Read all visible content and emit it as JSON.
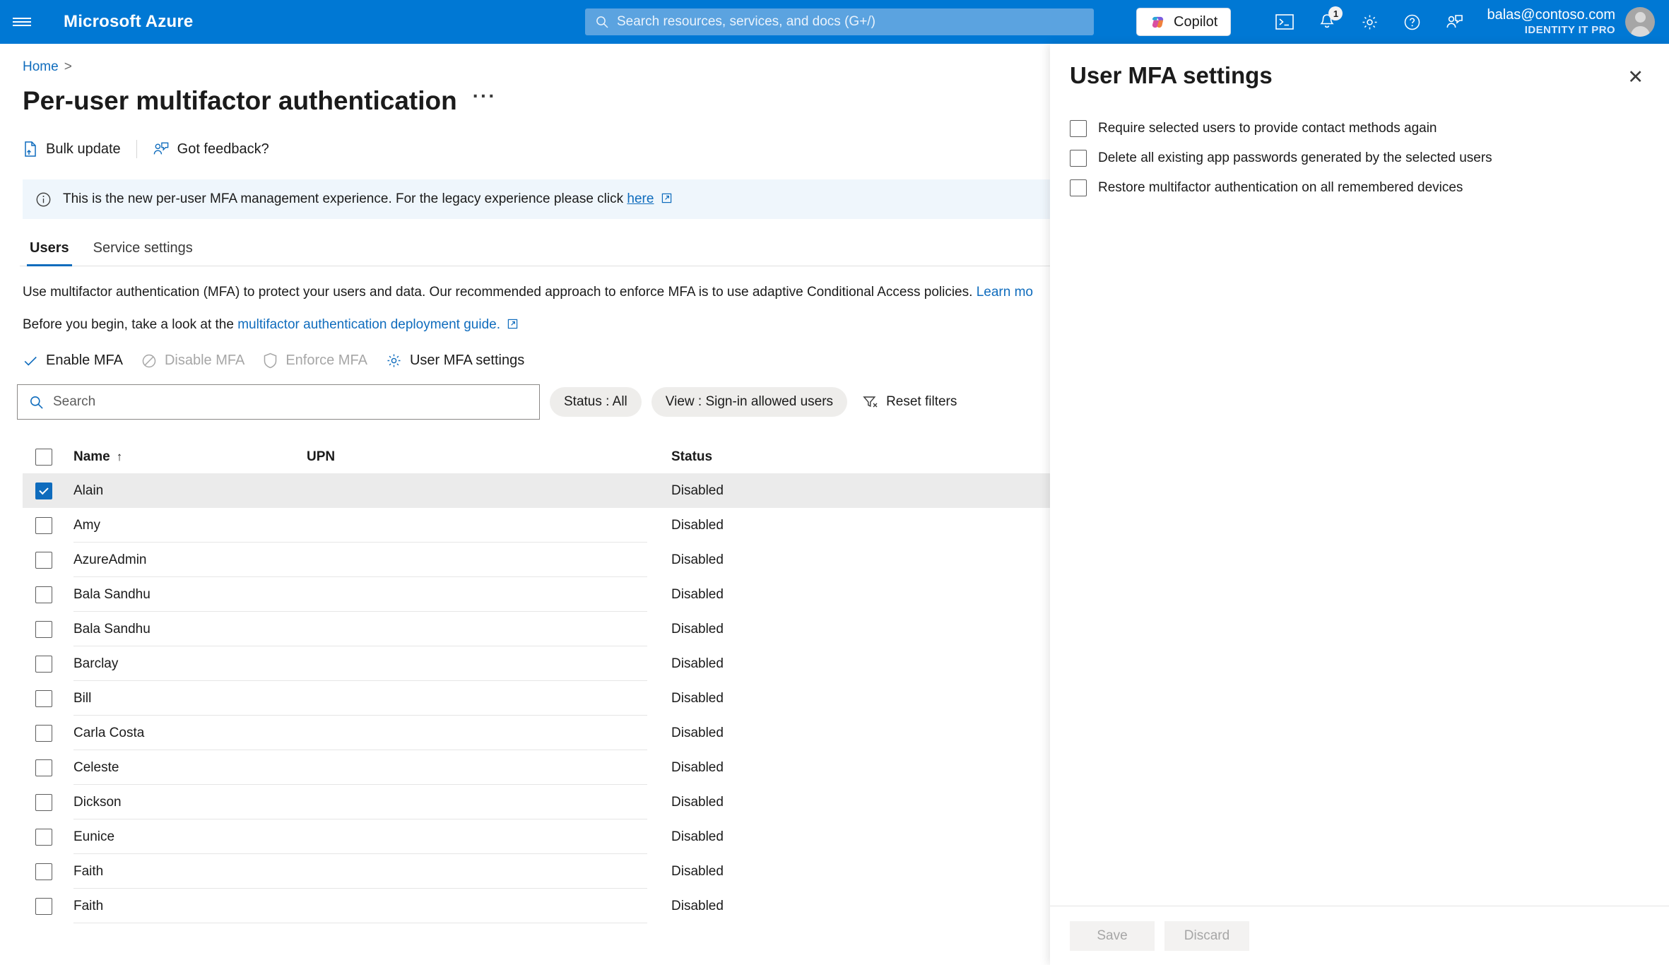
{
  "topbar": {
    "menu_icon": "hamburger-icon",
    "brand": "Microsoft Azure",
    "search_placeholder": "Search resources, services, and docs (G+/)",
    "search_icon": "search-icon",
    "copilot_label": "Copilot",
    "copilot_icon": "copilot-icon",
    "icons": [
      {
        "name": "cloud-shell-icon",
        "glyph": ">_"
      },
      {
        "name": "notifications-icon",
        "badge": "1"
      },
      {
        "name": "gear-icon"
      },
      {
        "name": "help-icon"
      },
      {
        "name": "feedback-icon"
      }
    ],
    "account": {
      "email": "balas@contoso.com",
      "org": "IDENTITY IT PRO",
      "avatar": "avatar"
    },
    "accent_color": "#0078d4"
  },
  "page": {
    "breadcrumb": {
      "home": "Home",
      "separator": ">"
    },
    "title": "Per-user multifactor authentication",
    "more_menu": "···",
    "commands": [
      {
        "label": "Bulk update",
        "icon": "bulk-update-icon",
        "disabled": false
      },
      {
        "label": "Got feedback?",
        "icon": "feedback-icon",
        "disabled": false
      }
    ],
    "info_banner": {
      "icon": "info-icon",
      "text_before": "This is the new per-user MFA management experience. For the legacy experience please click",
      "link": "here",
      "external_icon": "external-link-icon",
      "background": "#eff6fc"
    },
    "tabs": [
      {
        "label": "Users",
        "active": true
      },
      {
        "label": "Service settings",
        "active": false
      }
    ],
    "paragraphs": {
      "p1_before": "Use multifactor authentication (MFA) to protect your users and data. Our recommended approach to enforce MFA is to use adaptive Conditional Access policies.",
      "p1_link": "Learn mo",
      "p2_before": "Before you begin, take a look at the",
      "p2_link": "multifactor authentication deployment guide.",
      "p2_external_icon": "external-link-icon"
    },
    "actions": [
      {
        "label": "Enable MFA",
        "icon": "check-icon",
        "disabled": false
      },
      {
        "label": "Disable MFA",
        "icon": "block-icon",
        "disabled": true
      },
      {
        "label": "Enforce MFA",
        "icon": "shield-icon",
        "disabled": true
      },
      {
        "label": "User MFA settings",
        "icon": "gear-icon",
        "disabled": false
      }
    ],
    "filters": {
      "search_placeholder": "Search",
      "search_value": "",
      "search_icon": "search-icon",
      "status_pill": "Status : All",
      "view_pill": "View : Sign-in allowed users",
      "reset_label": "Reset filters",
      "reset_icon": "filter-clear-icon"
    },
    "table": {
      "columns": [
        "Name",
        "UPN",
        "Status"
      ],
      "sort_column": "Name",
      "sort_arrow": "↑",
      "select_all_checked": false,
      "rows": [
        {
          "name": "Alain",
          "upn": "",
          "status": "Disabled",
          "checked": true
        },
        {
          "name": "Amy",
          "upn": "",
          "status": "Disabled",
          "checked": false
        },
        {
          "name": "AzureAdmin",
          "upn": "",
          "status": "Disabled",
          "checked": false
        },
        {
          "name": "Bala Sandhu",
          "upn": "",
          "status": "Disabled",
          "checked": false
        },
        {
          "name": "Bala Sandhu",
          "upn": "",
          "status": "Disabled",
          "checked": false
        },
        {
          "name": "Barclay",
          "upn": "",
          "status": "Disabled",
          "checked": false
        },
        {
          "name": "Bill",
          "upn": "",
          "status": "Disabled",
          "checked": false
        },
        {
          "name": "Carla Costa",
          "upn": "",
          "status": "Disabled",
          "checked": false
        },
        {
          "name": "Celeste",
          "upn": "",
          "status": "Disabled",
          "checked": false
        },
        {
          "name": "Dickson",
          "upn": "",
          "status": "Disabled",
          "checked": false
        },
        {
          "name": "Eunice",
          "upn": "",
          "status": "Disabled",
          "checked": false
        },
        {
          "name": "Faith",
          "upn": "",
          "status": "Disabled",
          "checked": false
        },
        {
          "name": "Faith",
          "upn": "",
          "status": "Disabled",
          "checked": false
        }
      ]
    }
  },
  "panel": {
    "title": "User MFA settings",
    "close_icon": "close-icon",
    "checkboxes": [
      {
        "label": "Require selected users to provide contact methods again",
        "checked": false
      },
      {
        "label": "Delete all existing app passwords generated by the selected users",
        "checked": false
      },
      {
        "label": "Restore multifactor authentication on all remembered devices",
        "checked": false
      }
    ],
    "save_label": "Save",
    "discard_label": "Discard",
    "save_disabled": true,
    "discard_disabled": true
  }
}
